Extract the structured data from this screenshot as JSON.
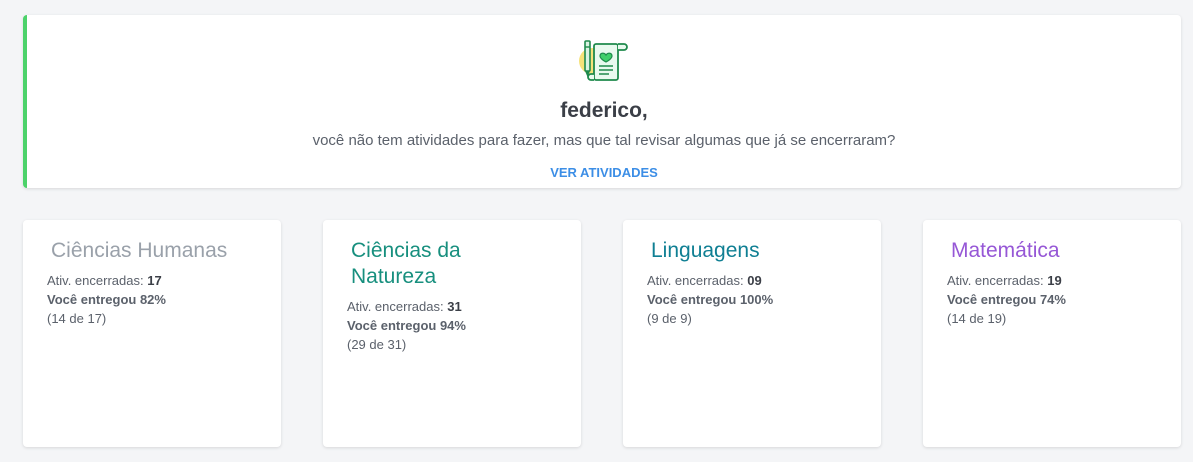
{
  "banner": {
    "icon": "heart-scroll-pen-icon",
    "greeting": "federico,",
    "message": "você não tem atividades para fazer, mas que tal revisar algumas que já se encerraram?",
    "cta_label": "VER ATIVIDADES",
    "accent_color": "#4cd26a",
    "cta_color": "#3c8ee6"
  },
  "subjects": [
    {
      "title": "Ciências Humanas",
      "color": "#9aa1aa",
      "closed_label": "Ativ. encerradas:",
      "closed_count": "17",
      "delivered": "Você entregou 82%",
      "fraction": "(14 de 17)"
    },
    {
      "title": "Ciências da Natureza",
      "color": "#178f7e",
      "closed_label": "Ativ. encerradas:",
      "closed_count": "31",
      "delivered": "Você entregou 94%",
      "fraction": "(29 de 31)"
    },
    {
      "title": "Linguagens",
      "color": "#0f7f93",
      "closed_label": "Ativ. encerradas:",
      "closed_count": "09",
      "delivered": "Você entregou 100%",
      "fraction": "(9 de 9)"
    },
    {
      "title": "Matemática",
      "color": "#9657d6",
      "closed_label": "Ativ. encerradas:",
      "closed_count": "19",
      "delivered": "Você entregou 74%",
      "fraction": "(14 de 19)"
    }
  ]
}
